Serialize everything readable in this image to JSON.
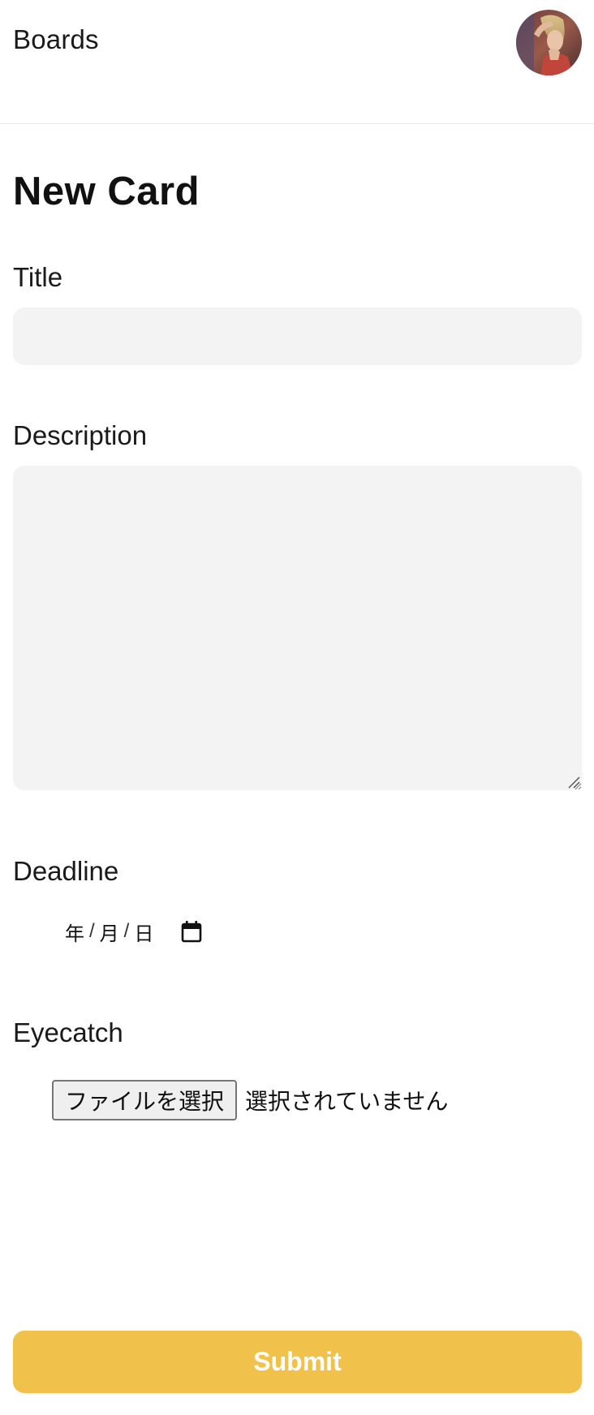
{
  "header": {
    "brand_label": "Boards",
    "avatar_icon": "user-avatar-photo"
  },
  "form": {
    "heading": "New Card",
    "title": {
      "label": "Title",
      "value": "",
      "placeholder": ""
    },
    "description": {
      "label": "Description",
      "value": "",
      "placeholder": ""
    },
    "deadline": {
      "label": "Deadline",
      "year_placeholder": "年",
      "month_placeholder": "月",
      "day_placeholder": "日",
      "separator": "/",
      "icon": "calendar-icon"
    },
    "eyecatch": {
      "label": "Eyecatch",
      "button_label": "ファイルを選択",
      "status_text": "選択されていません"
    },
    "submit_label": "Submit"
  },
  "colors": {
    "accent": "#f0c14b",
    "input_background": "#f3f3f3",
    "header_border": "#e8e8e8"
  }
}
